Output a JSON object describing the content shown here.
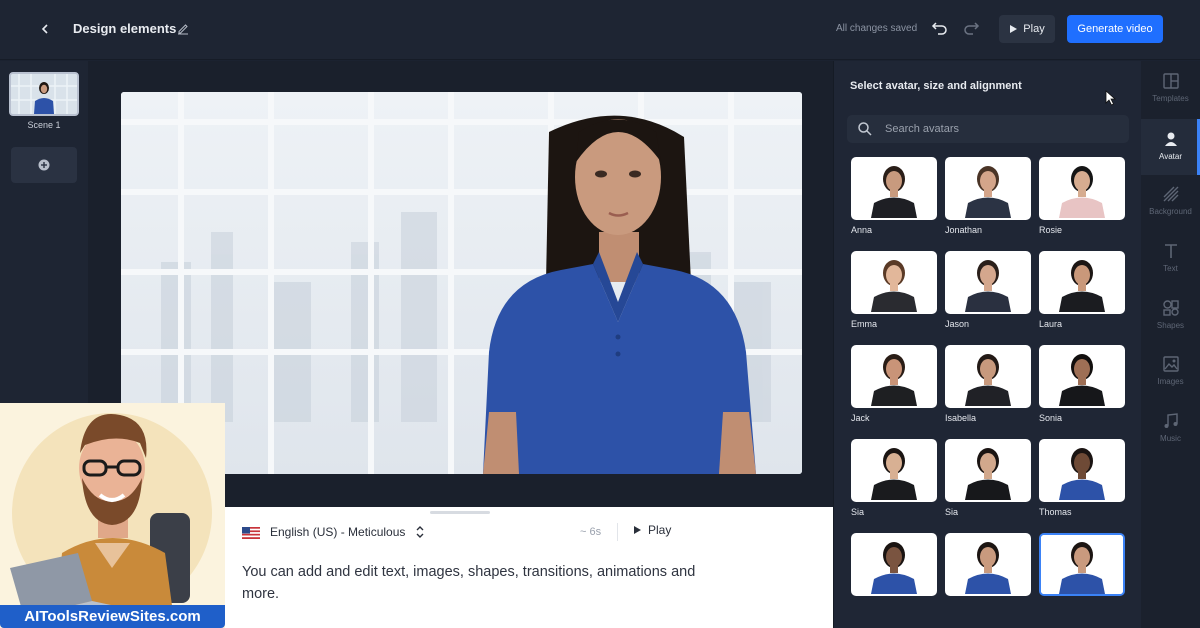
{
  "header": {
    "back_icon": "chevron-left-icon",
    "title": "Design elements",
    "edit_icon": "pencil-icon",
    "save_status": "All changes saved",
    "undo_icon": "undo-icon",
    "redo_icon": "redo-icon",
    "play_label": "Play",
    "generate_label": "Generate video"
  },
  "scenes": {
    "items": [
      {
        "label": "Scene 1"
      }
    ],
    "add_icon": "plus-circle-icon"
  },
  "script": {
    "language": "English (US) - Meticulous",
    "flag_icon": "us-flag-icon",
    "duration": "~ 6s",
    "play_label": "Play",
    "text": "You can add and edit text, images, shapes, transitions, animations and more."
  },
  "avatar_panel": {
    "title": "Select avatar, size and alignment",
    "search_placeholder": "Search avatars",
    "avatars": [
      {
        "name": "Anna",
        "shirt": "#1e1f24",
        "hair": "#2a1e18",
        "skin": "#c89a7e"
      },
      {
        "name": "Jonathan",
        "shirt": "#2b3344",
        "hair": "#4a3426",
        "skin": "#d4a58a"
      },
      {
        "name": "Rosie",
        "shirt": "#e8c4c4",
        "hair": "#151515",
        "skin": "#d6ac90"
      },
      {
        "name": "Emma",
        "shirt": "#2a2b30",
        "hair": "#5a3a26",
        "skin": "#e2b79a"
      },
      {
        "name": "Jason",
        "shirt": "#2a3040",
        "hair": "#2a1f1a",
        "skin": "#d4a78d"
      },
      {
        "name": "Laura",
        "shirt": "#1b1c20",
        "hair": "#1c1614",
        "skin": "#c9987a"
      },
      {
        "name": "Jack",
        "shirt": "#1e1f22",
        "hair": "#2a1d16",
        "skin": "#c99478"
      },
      {
        "name": "Isabella",
        "shirt": "#202126",
        "hair": "#231a16",
        "skin": "#c7997d"
      },
      {
        "name": "Sonia",
        "shirt": "#16171a",
        "hair": "#120f0e",
        "skin": "#9e6f55"
      },
      {
        "name": "Sia",
        "shirt": "#1a1b1e",
        "hair": "#1a1412",
        "skin": "#d8b093"
      },
      {
        "name": "Sia",
        "shirt": "#17181b",
        "hair": "#1a1412",
        "skin": "#d2a88c"
      },
      {
        "name": "Thomas",
        "shirt": "#2d52a8",
        "hair": "#1a1412",
        "skin": "#6e4a36"
      },
      {
        "name": "",
        "shirt": "#2d52a8",
        "hair": "#1a1412",
        "skin": "#7a5440"
      },
      {
        "name": "",
        "shirt": "#2d52a8",
        "hair": "#1c1512",
        "skin": "#c99a7e"
      },
      {
        "name": "",
        "shirt": "#2d52a8",
        "hair": "#1c1512",
        "skin": "#c99a7e",
        "selected": true
      }
    ]
  },
  "tools": [
    {
      "label": "Templates",
      "icon": "templates-icon"
    },
    {
      "label": "Avatar",
      "icon": "avatar-icon",
      "active": true
    },
    {
      "label": "Background",
      "icon": "background-icon"
    },
    {
      "label": "Text",
      "icon": "text-icon"
    },
    {
      "label": "Shapes",
      "icon": "shapes-icon"
    },
    {
      "label": "Images",
      "icon": "images-icon"
    },
    {
      "label": "Music",
      "icon": "music-icon"
    }
  ],
  "watermark": {
    "label": "AIToolsReviewSites.com"
  },
  "colors": {
    "accent": "#1f6fff",
    "shirt_blue": "#2d52a8",
    "app_bg": "#1b2230"
  }
}
